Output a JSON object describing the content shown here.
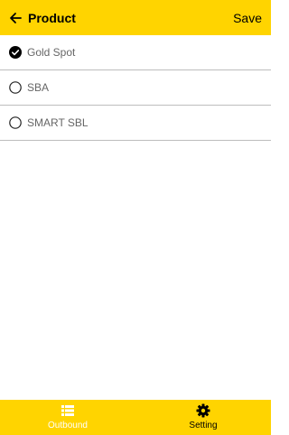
{
  "header": {
    "title": "Product",
    "save_label": "Save",
    "background_color": "#ffd400"
  },
  "products": [
    {
      "label": "Gold Spot",
      "selected": true
    },
    {
      "label": "SBA",
      "selected": false
    },
    {
      "label": "SMART SBL",
      "selected": false
    }
  ],
  "bottom_nav": {
    "tabs": [
      {
        "label": "Outbound",
        "icon": "list-icon",
        "active": false
      },
      {
        "label": "Setting",
        "icon": "gear-icon",
        "active": true
      }
    ]
  }
}
